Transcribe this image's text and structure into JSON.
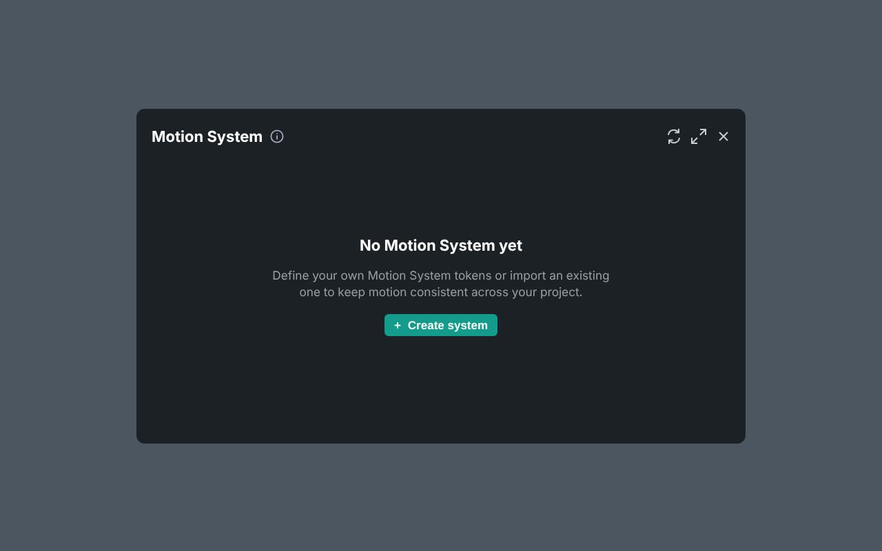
{
  "panel": {
    "title": "Motion System"
  },
  "empty_state": {
    "heading": "No Motion System yet",
    "description": "Define your own Motion System tokens or import an existing one to keep motion consistent across your project.",
    "button": {
      "icon": "+",
      "label": "Create system"
    }
  }
}
